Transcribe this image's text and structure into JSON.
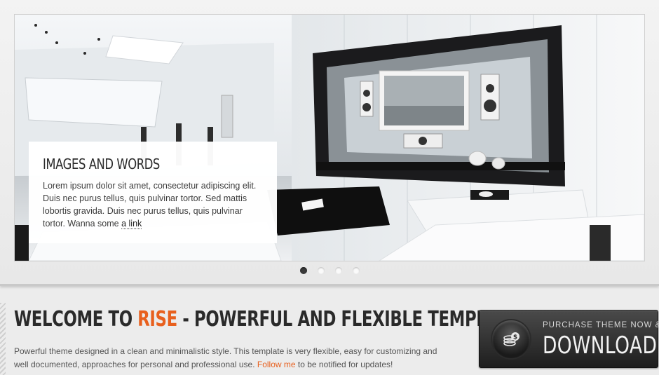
{
  "slider": {
    "caption_title": "IMAGES AND WORDS",
    "caption_text": "Lorem ipsum dolor sit amet, consectetur adipiscing elit. Duis nec purus tellus, quis pulvinar tortor. Sed mattis lobortis gravida. Duis nec purus tellus, quis pulvinar tortor. Wanna some ",
    "caption_link": "a link",
    "active_slide": 1,
    "slide_count": 4
  },
  "welcome": {
    "title_prefix": "WELCOME TO ",
    "title_brand": "RISE",
    "title_suffix": " - POWERFUL AND FLEXIBLE TEMPLATE",
    "description": "Powerful theme designed in a clean and minimalistic style. This template is very flexible, easy for customizing and well documented, approaches for personal and professional use. ",
    "follow_link": "Follow me",
    "description_end": " to be notified for updates!"
  },
  "download_button": {
    "small_label": "PURCHASE THEME NOW &",
    "big_label": "DOWNLOAD",
    "icon": "money-coin-icon"
  },
  "colors": {
    "accent": "#e8601e",
    "button_dark": "#2a2a2a"
  }
}
